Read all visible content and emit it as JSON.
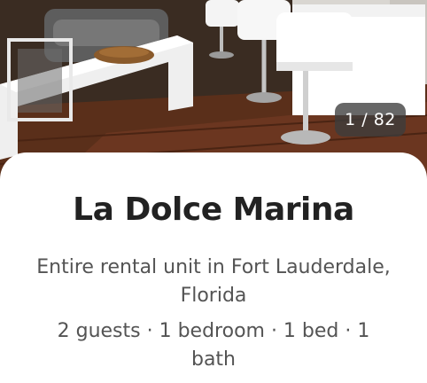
{
  "photo": {
    "counter_current": "1",
    "counter_total": "82",
    "counter_separator": " / "
  },
  "listing": {
    "title": "La Dolce Marina",
    "subtitle": "Entire rental unit in Fort Lauderdale, Florida",
    "facts": "2 guests · 1 bedroom · 1 bed · 1 bath"
  },
  "colors": {
    "title": "#222222",
    "secondary_text": "#545454",
    "counter_bg": "#3c3c3c",
    "sheet_bg": "#ffffff"
  }
}
